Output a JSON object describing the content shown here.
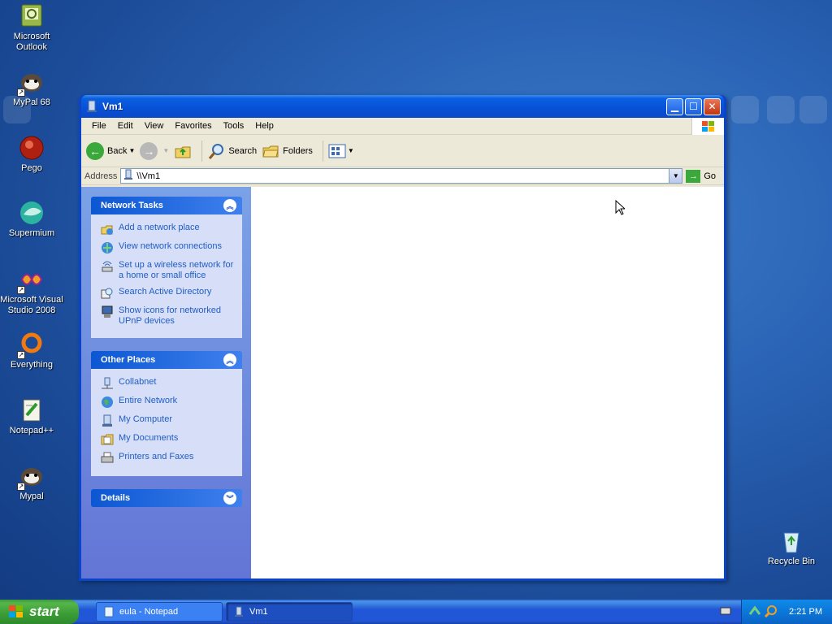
{
  "desktop": {
    "icons": [
      {
        "label": "Microsoft Outlook",
        "icon": "outlook-icon"
      },
      {
        "label": "MyPal 68",
        "icon": "raccoon-icon"
      },
      {
        "label": "Pego",
        "icon": "pego-icon"
      },
      {
        "label": "Supermium",
        "icon": "supermium-icon"
      },
      {
        "label": "Microsoft Visual Studio 2008",
        "icon": "visual-studio-icon"
      },
      {
        "label": "Everything",
        "icon": "everything-icon"
      },
      {
        "label": "Notepad++",
        "icon": "notepadpp-icon"
      },
      {
        "label": "Mypal",
        "icon": "raccoon-icon"
      },
      {
        "label": "Recycle Bin",
        "icon": "recycle-bin-icon"
      }
    ]
  },
  "window": {
    "title": "Vm1",
    "menu": [
      "File",
      "Edit",
      "View",
      "Favorites",
      "Tools",
      "Help"
    ],
    "toolbar": {
      "back": "Back",
      "search": "Search",
      "folders": "Folders"
    },
    "address": {
      "label": "Address",
      "value": "\\\\Vm1",
      "go": "Go"
    },
    "network_tasks": {
      "title": "Network Tasks",
      "items": [
        {
          "label": "Add a network place",
          "icon": "add-network-place-icon"
        },
        {
          "label": "View network connections",
          "icon": "network-connections-icon"
        },
        {
          "label": "Set up a wireless network for a home or small office",
          "icon": "wireless-icon"
        },
        {
          "label": "Search Active Directory",
          "icon": "search-directory-icon"
        },
        {
          "label": "Show icons for networked UPnP devices",
          "icon": "upnp-icon"
        }
      ]
    },
    "other_places": {
      "title": "Other Places",
      "items": [
        {
          "label": "Collabnet",
          "icon": "network-share-icon"
        },
        {
          "label": "Entire Network",
          "icon": "globe-icon"
        },
        {
          "label": "My Computer",
          "icon": "computer-icon"
        },
        {
          "label": "My Documents",
          "icon": "documents-icon"
        },
        {
          "label": "Printers and Faxes",
          "icon": "printer-icon"
        }
      ]
    },
    "details": {
      "title": "Details"
    }
  },
  "taskbar": {
    "start": "start",
    "tasks": [
      {
        "label": "eula - Notepad",
        "active": false
      },
      {
        "label": "Vm1",
        "active": true
      }
    ],
    "clock": "2:21 PM"
  }
}
